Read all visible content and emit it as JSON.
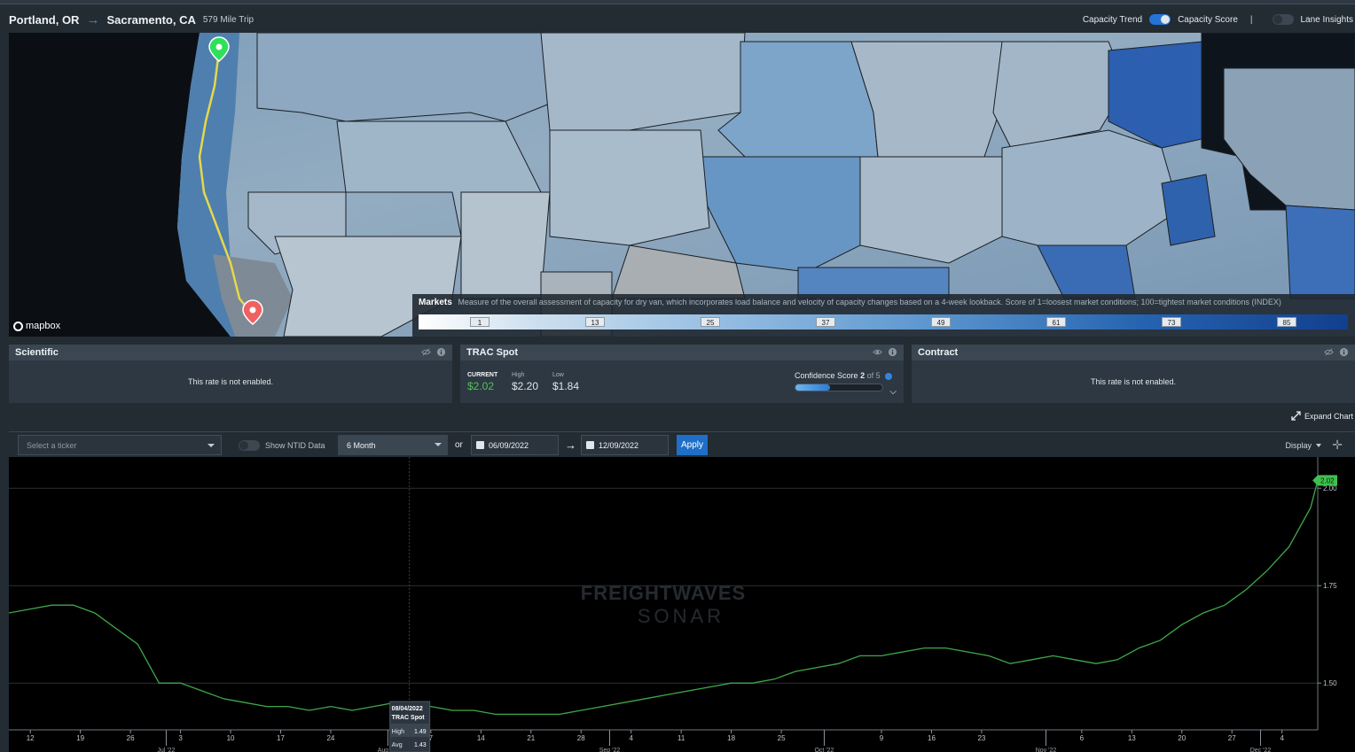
{
  "header": {
    "origin": "Portland, OR",
    "destination": "Sacramento, CA",
    "trip": "579 Mile Trip",
    "capacity_trend_label": "Capacity Trend",
    "capacity_score_label": "Capacity Score",
    "divider": "|",
    "lane_insights_label": "Lane Insights"
  },
  "map": {
    "attribution": "mapbox",
    "legend_title": "Markets",
    "legend_description": "Measure of the overall assessment of capacity for dry van, which incorporates load balance and velocity of capacity changes based on a 4-week lookback. Score of 1=loosest market conditions; 100=tightest market conditions (INDEX)",
    "legend_ticks": [
      "1",
      "13",
      "25",
      "37",
      "49",
      "61",
      "73",
      "85"
    ]
  },
  "panels": {
    "scientific": {
      "title": "Scientific",
      "message": "This rate is not enabled."
    },
    "trac": {
      "title": "TRAC Spot",
      "current_label": "CURRENT",
      "current_value": "$2.02",
      "high_label": "High",
      "high_value": "$2.20",
      "low_label": "Low",
      "low_value": "$1.84",
      "confidence_label": "Confidence Score",
      "confidence_value": "2",
      "confidence_suffix": "of 5",
      "confidence_fraction": 0.4
    },
    "contract": {
      "title": "Contract",
      "message": "This rate is not enabled."
    }
  },
  "expand_label": "Expand Chart",
  "toolbar": {
    "ticker_placeholder": "Select a ticker",
    "ntid_label": "Show NTID Data",
    "range_value": "6 Month",
    "or_label": "or",
    "start_date": "06/09/2022",
    "end_date": "12/09/2022",
    "apply_label": "Apply",
    "display_label": "Display"
  },
  "chart_data": {
    "type": "line",
    "watermark_top": "FREIGHTWAVES",
    "watermark_bottom": "SONAR",
    "series": [
      {
        "color": "#3fa84a",
        "x": [
          "2022-06-09",
          "2022-06-12",
          "2022-06-15",
          "2022-06-18",
          "2022-06-21",
          "2022-06-24",
          "2022-06-27",
          "2022-06-30",
          "2022-07-03",
          "2022-07-06",
          "2022-07-09",
          "2022-07-12",
          "2022-07-15",
          "2022-07-18",
          "2022-07-21",
          "2022-07-24",
          "2022-07-27",
          "2022-07-30",
          "2022-08-02",
          "2022-08-04",
          "2022-08-07",
          "2022-08-10",
          "2022-08-13",
          "2022-08-16",
          "2022-08-19",
          "2022-08-22",
          "2022-08-25",
          "2022-08-28",
          "2022-08-31",
          "2022-09-03",
          "2022-09-06",
          "2022-09-09",
          "2022-09-12",
          "2022-09-15",
          "2022-09-18",
          "2022-09-21",
          "2022-09-24",
          "2022-09-27",
          "2022-09-30",
          "2022-10-03",
          "2022-10-06",
          "2022-10-09",
          "2022-10-12",
          "2022-10-15",
          "2022-10-18",
          "2022-10-21",
          "2022-10-24",
          "2022-10-27",
          "2022-10-30",
          "2022-11-02",
          "2022-11-05",
          "2022-11-08",
          "2022-11-11",
          "2022-11-14",
          "2022-11-17",
          "2022-11-20",
          "2022-11-23",
          "2022-11-26",
          "2022-11-29",
          "2022-12-02",
          "2022-12-05",
          "2022-12-08",
          "2022-12-09"
        ],
        "y": [
          1.68,
          1.69,
          1.7,
          1.7,
          1.68,
          1.64,
          1.6,
          1.5,
          1.5,
          1.48,
          1.46,
          1.45,
          1.44,
          1.44,
          1.43,
          1.44,
          1.43,
          1.44,
          1.45,
          1.43,
          1.44,
          1.43,
          1.43,
          1.42,
          1.42,
          1.42,
          1.42,
          1.43,
          1.44,
          1.45,
          1.46,
          1.47,
          1.48,
          1.49,
          1.5,
          1.5,
          1.51,
          1.53,
          1.54,
          1.55,
          1.57,
          1.57,
          1.58,
          1.59,
          1.59,
          1.58,
          1.57,
          1.55,
          1.56,
          1.57,
          1.56,
          1.55,
          1.56,
          1.59,
          1.61,
          1.65,
          1.68,
          1.7,
          1.74,
          1.79,
          1.85,
          1.95,
          2.02
        ]
      }
    ],
    "tooltip": {
      "date": "08/04/2022",
      "series": "TRAC Spot",
      "high_label": "High",
      "high_value": "1.49",
      "avg_label": "Avg",
      "avg_value": "1.43"
    },
    "last_value_label": "2.02",
    "y_ticks": [
      1.5,
      1.75,
      2.0
    ],
    "y_tick_labels": [
      "1.50",
      "1.75",
      "2.00"
    ],
    "ylim": [
      1.38,
      2.08
    ],
    "x_ticks": [
      {
        "date": "2022-06-12",
        "label": "12"
      },
      {
        "date": "2022-06-19",
        "label": "19"
      },
      {
        "date": "2022-06-26",
        "label": "26"
      },
      {
        "date": "2022-07-03",
        "label": "3"
      },
      {
        "date": "2022-07-10",
        "label": "10"
      },
      {
        "date": "2022-07-17",
        "label": "17"
      },
      {
        "date": "2022-07-24",
        "label": "24"
      },
      {
        "date": "2022-08-07",
        "label": "7"
      },
      {
        "date": "2022-08-14",
        "label": "14"
      },
      {
        "date": "2022-08-21",
        "label": "21"
      },
      {
        "date": "2022-08-28",
        "label": "28"
      },
      {
        "date": "2022-09-04",
        "label": "4"
      },
      {
        "date": "2022-09-11",
        "label": "11"
      },
      {
        "date": "2022-09-18",
        "label": "18"
      },
      {
        "date": "2022-09-25",
        "label": "25"
      },
      {
        "date": "2022-10-09",
        "label": "9"
      },
      {
        "date": "2022-10-16",
        "label": "16"
      },
      {
        "date": "2022-10-23",
        "label": "23"
      },
      {
        "date": "2022-11-06",
        "label": "6"
      },
      {
        "date": "2022-11-13",
        "label": "13"
      },
      {
        "date": "2022-11-20",
        "label": "20"
      },
      {
        "date": "2022-11-27",
        "label": "27"
      },
      {
        "date": "2022-12-04",
        "label": "4"
      }
    ],
    "month_ticks": [
      {
        "date": "2022-07-01",
        "label": "Jul '22"
      },
      {
        "date": "2022-08-01",
        "label": "Aug '22"
      },
      {
        "date": "2022-09-01",
        "label": "Sep '22"
      },
      {
        "date": "2022-10-01",
        "label": "Oct '22"
      },
      {
        "date": "2022-11-01",
        "label": "Nov '22"
      },
      {
        "date": "2022-12-01",
        "label": "Dec '22"
      }
    ],
    "xlim": [
      "2022-06-09",
      "2022-12-09"
    ]
  }
}
